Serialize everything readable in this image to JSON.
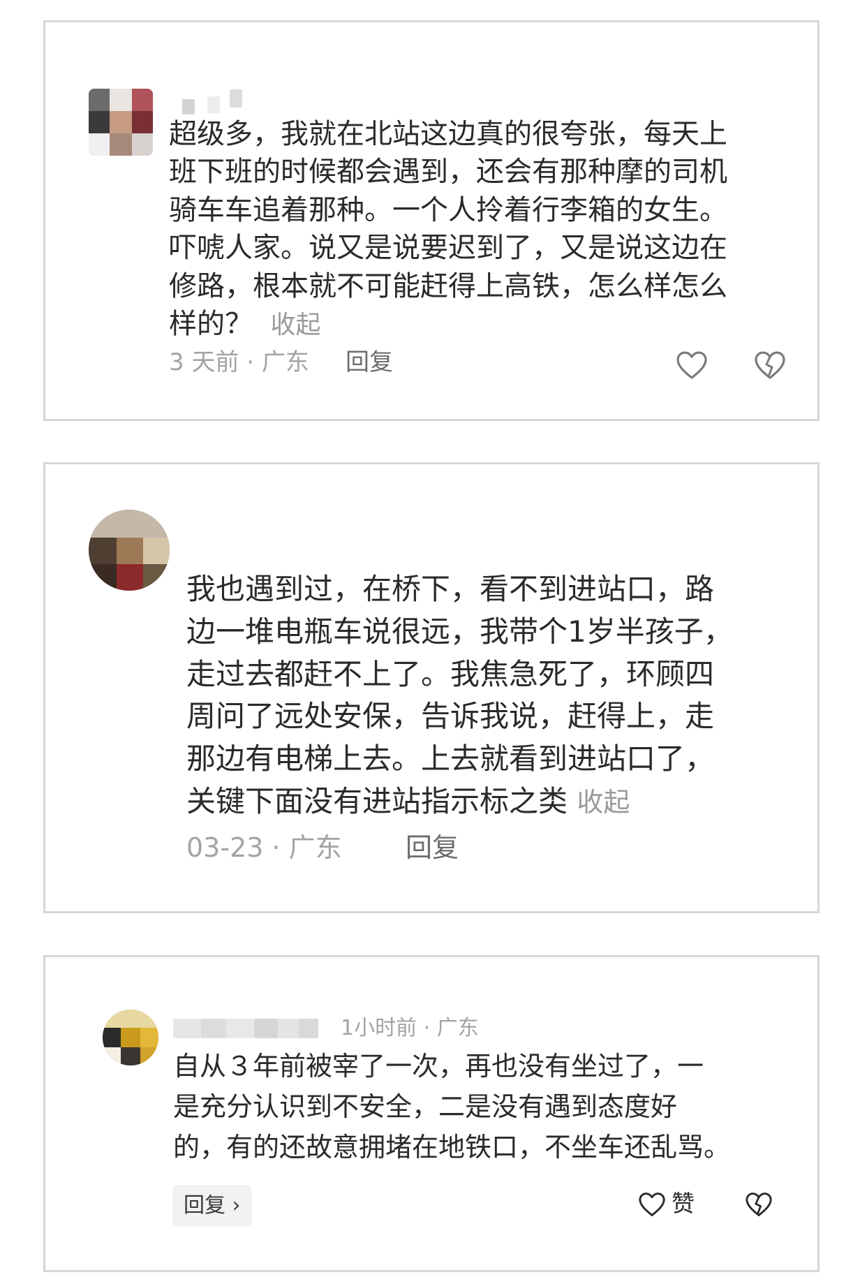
{
  "comments": [
    {
      "text_lines": [
        "超级多，我就在北站这边真的很夸张，每天上",
        "班下班的时候都会遇到，还会有那种摩的司机",
        "骑车车追着那种。一个人拎着行李箱的女生。",
        "吓唬人家。说又是说要迟到了，又是说这边在",
        "修路，根本就不可能赶得上高铁，怎么样怎么",
        "样的？"
      ],
      "collapse_label": "收起",
      "meta": "3 天前 · 广东",
      "reply_label": "回复",
      "icons": [
        "heart-outline-icon",
        "broken-heart-icon"
      ]
    },
    {
      "text_lines": [
        "我也遇到过，在桥下，看不到进站口，路",
        "边一堆电瓶车说很远，我带个1岁半孩子，",
        "走过去都赶不上了。我焦急死了，环顾四",
        "周问了远处安保，告诉我说，赶得上，走",
        "那边有电梯上去。上去就看到进站口了，",
        "关键下面没有进站指示标之类"
      ],
      "collapse_label": "收起",
      "meta": "03-23 · 广东",
      "reply_label": "回复"
    },
    {
      "meta": "1小时前 · 广东",
      "text_lines": [
        "自从３年前被宰了一次，再也没有坐过了，一",
        "是充分认识到不安全，二是没有遇到态度好",
        "的，有的还故意拥堵在地铁口，不坐车还乱骂。"
      ],
      "reply_label": "回复 ›",
      "like_label": "赞",
      "icons": [
        "heart-outline-icon",
        "broken-heart-icon"
      ]
    }
  ],
  "colors": {
    "text": "#2a2a2a",
    "muted": "#a3a3a3",
    "card_border": "#d4d6db"
  }
}
